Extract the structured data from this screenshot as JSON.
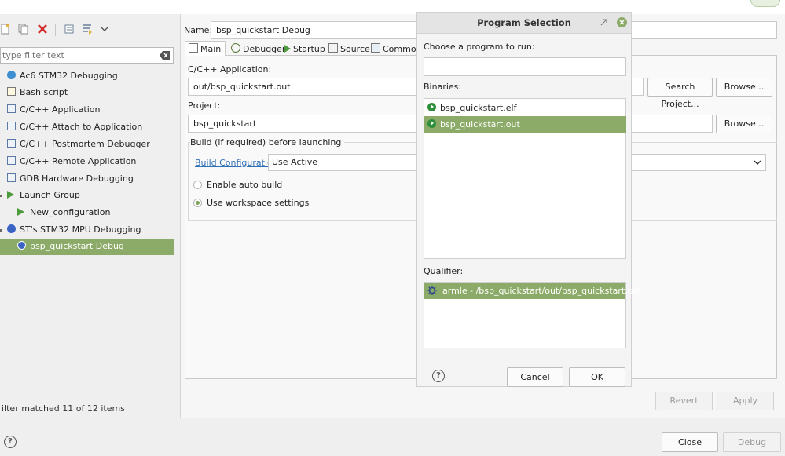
{
  "left_panel": {
    "filter_placeholder": "type filter text",
    "tree": [
      {
        "label": "Ac6 STM32 Debugging",
        "icon": "ac6-debug-icon"
      },
      {
        "label": "Bash script",
        "icon": "bash-script-icon"
      },
      {
        "label": "C/C++ Application",
        "icon": "c-app-icon"
      },
      {
        "label": "C/C++ Attach to Application",
        "icon": "c-app-icon"
      },
      {
        "label": "C/C++ Postmortem Debugger",
        "icon": "c-app-icon"
      },
      {
        "label": "C/C++ Remote Application",
        "icon": "c-app-icon"
      },
      {
        "label": "GDB Hardware Debugging",
        "icon": "c-app-icon"
      },
      {
        "label": "Launch Group",
        "icon": "launch-group-icon"
      },
      {
        "label": "New_configuration",
        "icon": "launch-config-icon"
      },
      {
        "label": "ST's STM32 MPU Debugging",
        "icon": "st-mpu-debug-icon"
      },
      {
        "label": "bsp_quickstart Debug",
        "icon": "st-mpu-debug-icon"
      }
    ],
    "status": "ilter matched 11 of 12 items"
  },
  "main": {
    "name_label": "Name:",
    "name_value": "bsp_quickstart Debug",
    "tabs": {
      "main": "Main",
      "debugger": "Debugger",
      "startup": "Startup",
      "source": "Source",
      "common": "Common"
    },
    "app_label": "C/C++ Application:",
    "app_value": "out/bsp_quickstart.out",
    "search_project": "Search Project...",
    "browse": "Browse...",
    "project_label": "Project:",
    "project_value": "bsp_quickstart",
    "build_group_label": "Build (if required) before launching",
    "build_config_link": "Build Configuration:",
    "build_config_value": "Use Active",
    "radio_auto": "Enable auto build",
    "radio_workspace": "Use workspace settings",
    "revert": "Revert",
    "apply": "Apply"
  },
  "footer": {
    "close": "Close",
    "debug": "Debug"
  },
  "dialog": {
    "title": "Program Selection",
    "choose_label": "Choose a program to run:",
    "choose_value": "",
    "binaries_label": "Binaries:",
    "binaries": [
      "bsp_quickstart.elf",
      "bsp_quickstart.out"
    ],
    "qualifier_label": "Qualifier:",
    "qualifier": "armle - /bsp_quickstart/out/bsp_quickstart.out",
    "cancel": "Cancel",
    "ok": "OK",
    "help": "?"
  },
  "colors": {
    "selection": "#8cab68",
    "link": "#2f6fb5"
  }
}
